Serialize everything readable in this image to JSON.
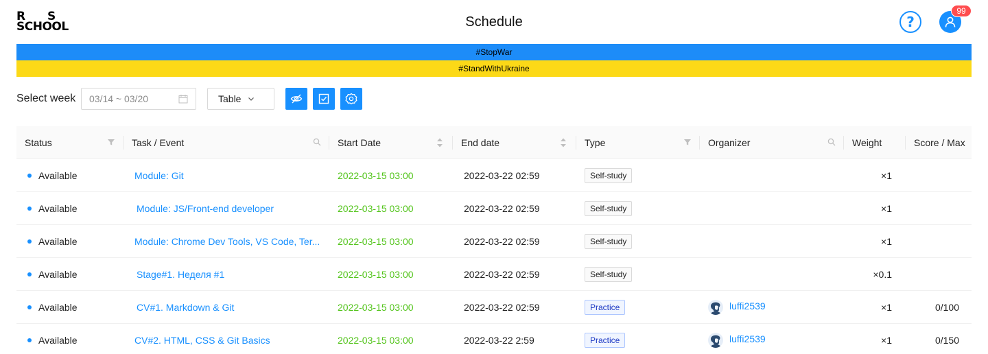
{
  "header": {
    "logo_r": "R",
    "logo_s": "S",
    "logo_school": "SCHOOL",
    "title": "Schedule",
    "help_icon": "question-circle-icon",
    "user_icon": "user-icon",
    "notification_count": "99",
    "accent_color": "#1890ff",
    "badge_color": "#ff4d4f"
  },
  "banner": {
    "line1": "#StopWar",
    "line2": "#StandWithUkraine",
    "color1": "#1d8cf8",
    "color2": "#fcd917"
  },
  "toolbar": {
    "select_week_label": "Select week",
    "date_range": "03/14 ~ 03/20",
    "view_mode": "Table",
    "buttons": [
      "eye-invisible-icon",
      "check-square-icon",
      "settings-icon"
    ]
  },
  "table": {
    "columns": [
      "Status",
      "Task / Event",
      "Start Date",
      "End date",
      "Type",
      "Organizer",
      "Weight",
      "Score / Max"
    ],
    "rows": [
      {
        "status": "Available",
        "task": "Module: Git",
        "start": "2022-03-15 03:00",
        "end": "2022-03-22 02:59",
        "type": "Self-study",
        "organizer": "",
        "weight": "×1",
        "score": ""
      },
      {
        "status": "Available",
        "task": "Module: JS/Front-end developer",
        "start": "2022-03-15 03:00",
        "end": "2022-03-22 02:59",
        "type": "Self-study",
        "organizer": "",
        "weight": "×1",
        "score": ""
      },
      {
        "status": "Available",
        "task": "Module: Chrome Dev Tools, VS Code, Ter...",
        "start": "2022-03-15 03:00",
        "end": "2022-03-22 02:59",
        "type": "Self-study",
        "organizer": "",
        "weight": "×1",
        "score": ""
      },
      {
        "status": "Available",
        "task": "Stage#1. Неделя #1",
        "start": "2022-03-15 03:00",
        "end": "2022-03-22 02:59",
        "type": "Self-study",
        "organizer": "",
        "weight": "×0.1",
        "score": ""
      },
      {
        "status": "Available",
        "task": "CV#1. Markdown & Git",
        "start": "2022-03-15 03:00",
        "end": "2022-03-22 02:59",
        "type": "Practice",
        "organizer": "luffi2539",
        "weight": "×1",
        "score": "0/100"
      },
      {
        "status": "Available",
        "task": "CV#2. HTML, CSS & Git Basics",
        "start": "2022-03-15 03:00",
        "end": "2022-03-22 2:59",
        "type": "Practice",
        "organizer": "luffi2539",
        "weight": "×1",
        "score": "0/150"
      }
    ]
  }
}
